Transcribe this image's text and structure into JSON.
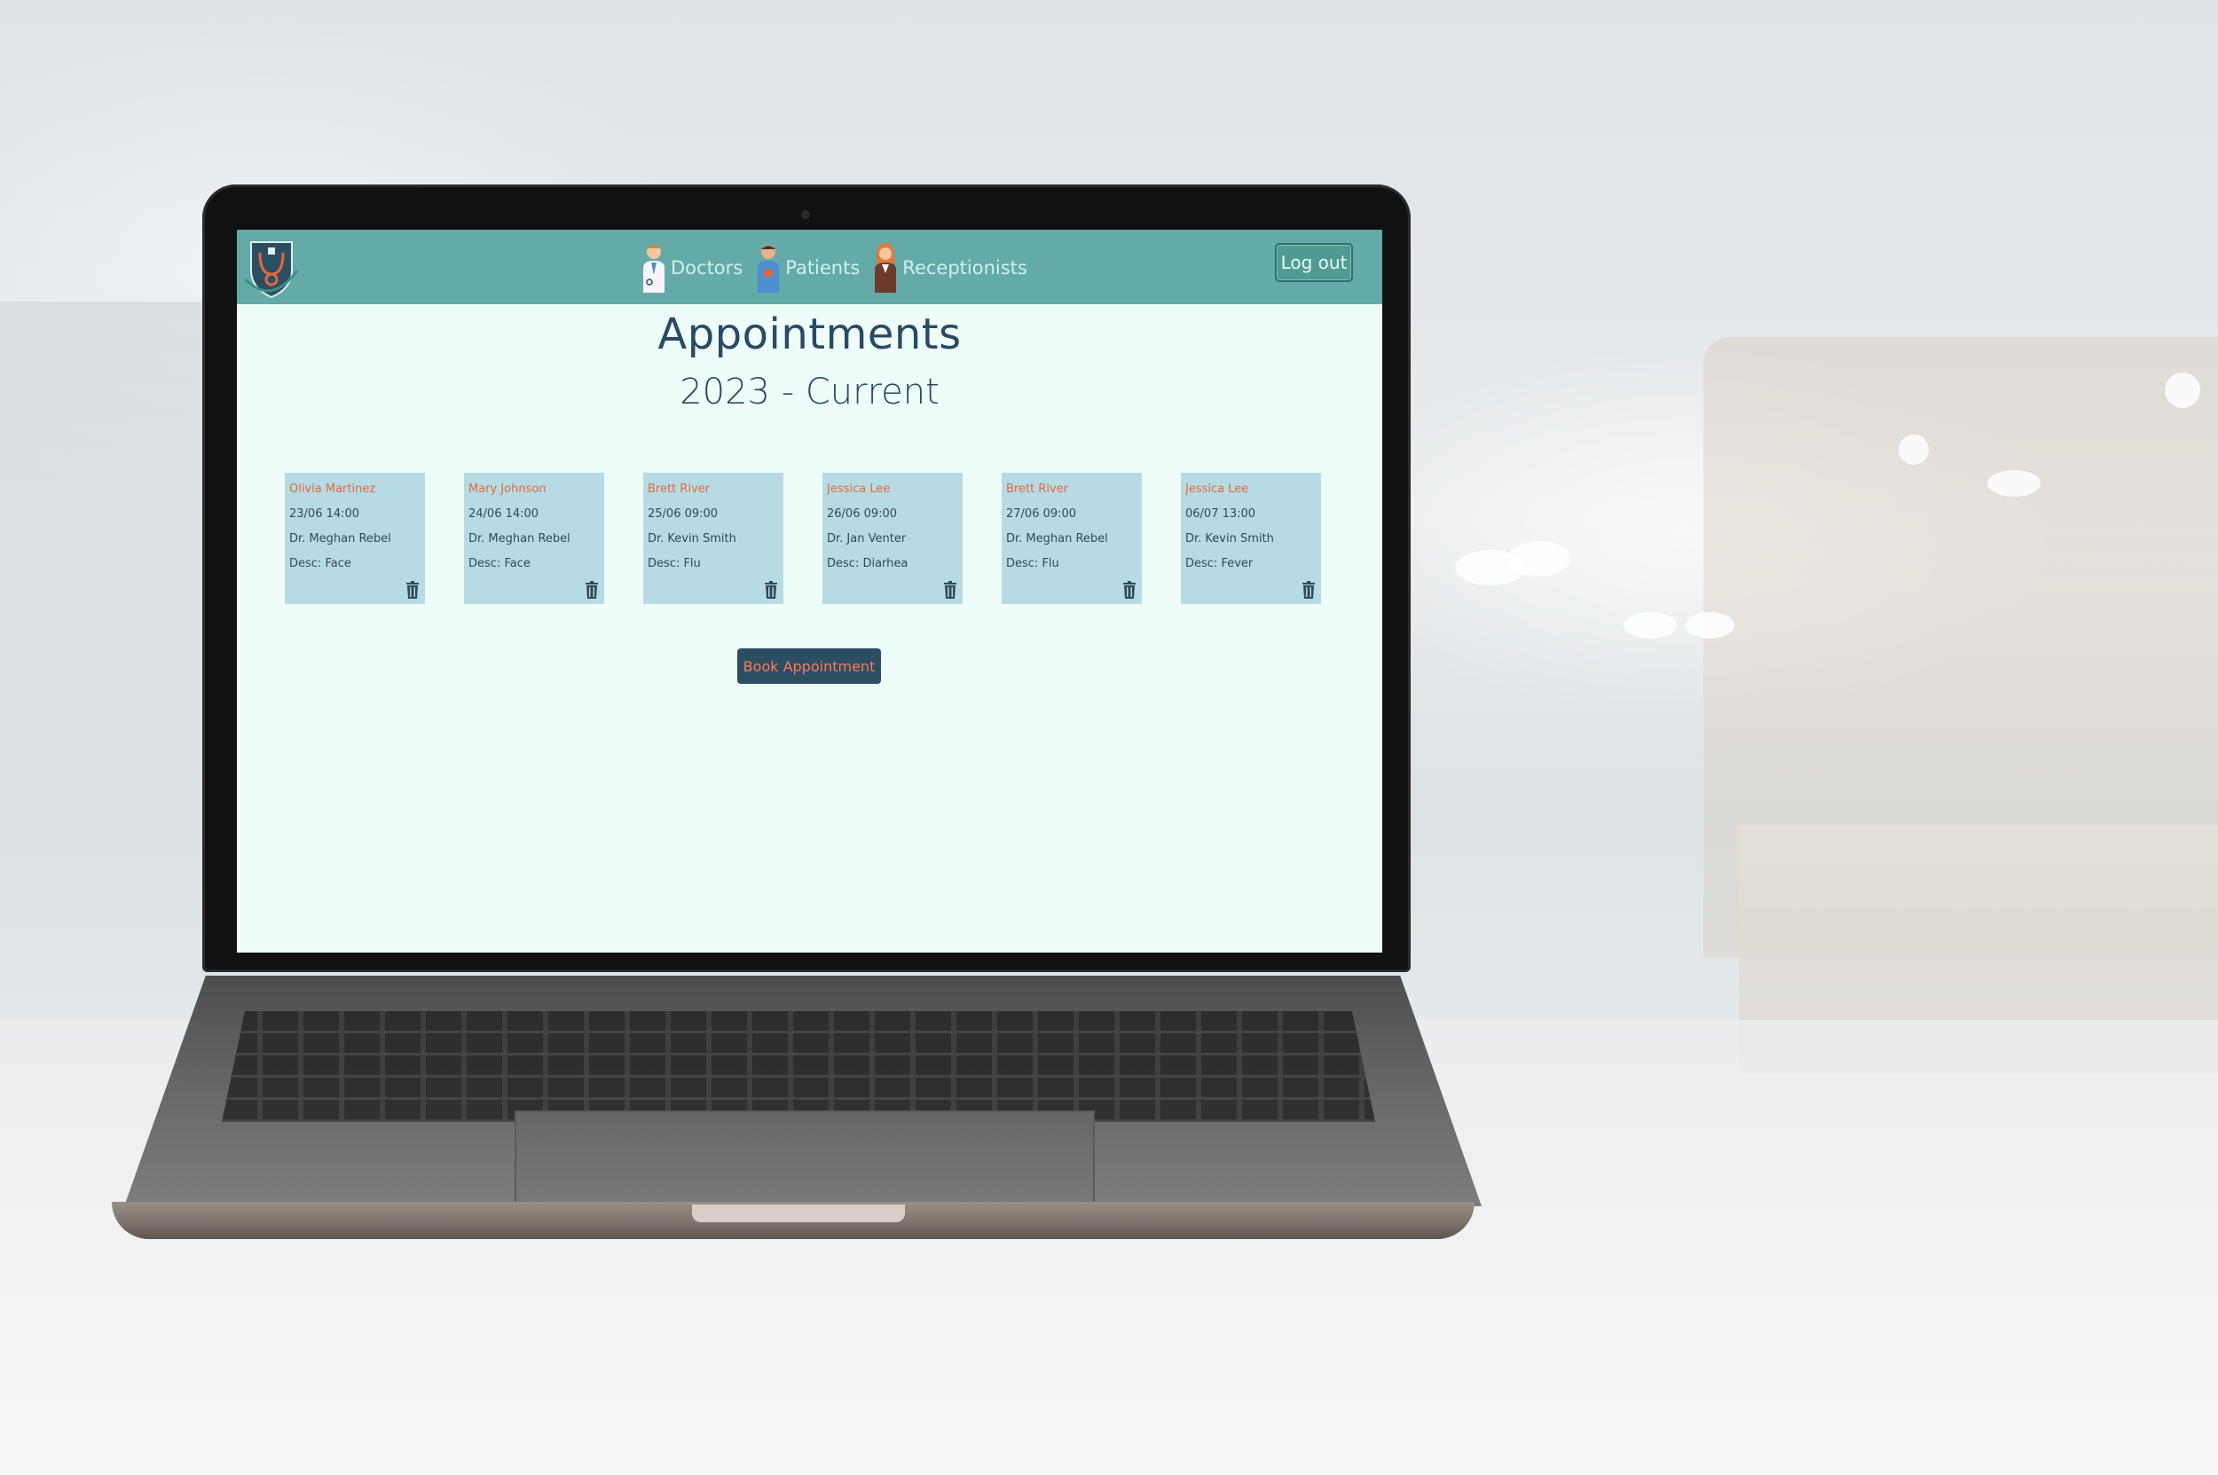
{
  "nav": {
    "links": [
      {
        "label": "Doctors",
        "icon": "doctor-icon"
      },
      {
        "label": "Patients",
        "icon": "patient-icon"
      },
      {
        "label": "Receptionists",
        "icon": "receptionist-icon"
      }
    ],
    "logout_label": "Log out",
    "logo_icon": "clinic-logo-icon"
  },
  "page": {
    "title": "Appointments",
    "subtitle": "2023 - Current"
  },
  "appointments": [
    {
      "patient": "Olivia Martinez",
      "datetime": "23/06 14:00",
      "doctor": "Dr. Meghan Rebel",
      "desc": "Desc: Face"
    },
    {
      "patient": "Mary Johnson",
      "datetime": "24/06 14:00",
      "doctor": "Dr. Meghan Rebel",
      "desc": "Desc: Face"
    },
    {
      "patient": "Brett River",
      "datetime": "25/06 09:00",
      "doctor": "Dr. Kevin Smith",
      "desc": "Desc: Flu"
    },
    {
      "patient": "Jessica Lee",
      "datetime": "26/06 09:00",
      "doctor": "Dr. Jan Venter",
      "desc": "Desc: Diarhea"
    },
    {
      "patient": "Brett River",
      "datetime": "27/06 09:00",
      "doctor": "Dr. Meghan Rebel",
      "desc": "Desc: Flu"
    },
    {
      "patient": "Jessica Lee",
      "datetime": "06/07 13:00",
      "doctor": "Dr. Kevin Smith",
      "desc": "Desc: Fever"
    }
  ],
  "book_button_label": "Book Appointment",
  "colors": {
    "navbar": "#63aaa8",
    "page_bg": "#effdf9",
    "card_bg": "#b6dbe4",
    "patient_name": "#e2683c",
    "heading": "#284a64",
    "book_button_bg": "#2c4e62",
    "book_button_text": "#ff7a5a"
  }
}
